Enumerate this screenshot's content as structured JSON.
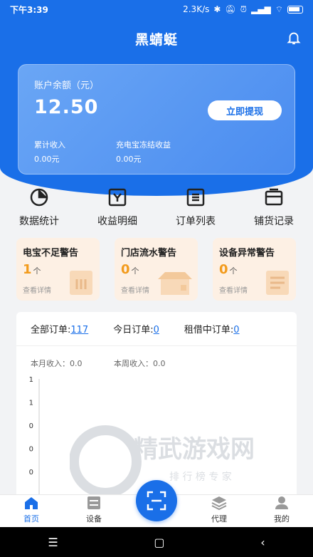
{
  "status_bar": {
    "time": "下午3:39",
    "speed": "2.3K/s"
  },
  "title": "黑蜻蜓",
  "balance": {
    "label": "账户余额（元）",
    "amount": "12.50",
    "withdraw_label": "立即提现",
    "total_income_label": "累计收入",
    "total_income_value": "0.00元",
    "frozen_label": "充电宝冻结收益",
    "frozen_value": "0.00元"
  },
  "menu": [
    {
      "label": "数据统计",
      "icon": "pie-chart-icon"
    },
    {
      "label": "收益明细",
      "icon": "income-detail-icon"
    },
    {
      "label": "订单列表",
      "icon": "order-list-icon"
    },
    {
      "label": "铺货记录",
      "icon": "stock-record-icon"
    }
  ],
  "warnings": [
    {
      "title": "电宝不足警告",
      "count": "1",
      "unit": "个",
      "detail": "查看详情"
    },
    {
      "title": "门店流水警告",
      "count": "0",
      "unit": "个",
      "detail": "查看详情"
    },
    {
      "title": "设备异常警告",
      "count": "0",
      "unit": "个",
      "detail": "查看详情"
    }
  ],
  "orders": {
    "all_label": "全部订单:",
    "all_value": "117",
    "today_label": "今日订单:",
    "today_value": "0",
    "renting_label": "租借中订单:",
    "renting_value": "0"
  },
  "income": {
    "month": "本月收入：0.0",
    "week": "本周收入：0.0"
  },
  "chart_data": {
    "type": "line",
    "y_ticks": [
      "1",
      "1",
      "0",
      "0",
      "0"
    ]
  },
  "watermark": {
    "title": "精武游戏网",
    "subtitle": "排 行 榜 专 家"
  },
  "nav": [
    {
      "label": "首页",
      "icon": "home-icon"
    },
    {
      "label": "设备",
      "icon": "device-icon"
    },
    {
      "label": "代理",
      "icon": "agent-icon"
    },
    {
      "label": "我的",
      "icon": "profile-icon"
    }
  ],
  "colors": {
    "primary": "#1a6fe8",
    "warning_bg": "#fdf0e4",
    "warning_num": "#f29b1d"
  }
}
